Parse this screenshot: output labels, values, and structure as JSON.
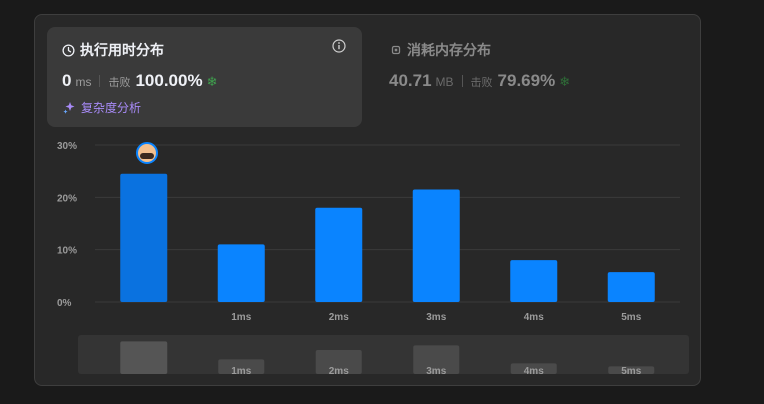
{
  "runtime": {
    "title": "执行用时分布",
    "value": "0",
    "unit": "ms",
    "beats_label": "击败",
    "beats_value": "100.00%",
    "complexity_label": "复杂度分析"
  },
  "memory": {
    "title": "消耗内存分布",
    "value": "40.71",
    "unit": "MB",
    "beats_label": "击败",
    "beats_value": "79.69%"
  },
  "colors": {
    "bar": "#0a84ff",
    "bar_active": "#0a72e0",
    "mini_bar": "#4a4a4a",
    "grid": "#3a3a3a"
  },
  "chart_data": {
    "type": "bar",
    "categories": [
      "",
      "1ms",
      "2ms",
      "3ms",
      "4ms",
      "5ms"
    ],
    "values": [
      24.5,
      11,
      18,
      21.5,
      8,
      5.7
    ],
    "y_ticks": [
      "0%",
      "10%",
      "20%",
      "30%"
    ],
    "ylim": [
      0,
      30
    ],
    "highlighted_index": 0,
    "overview_values": [
      24.5,
      11,
      18,
      21.5,
      8,
      5.7
    ]
  }
}
